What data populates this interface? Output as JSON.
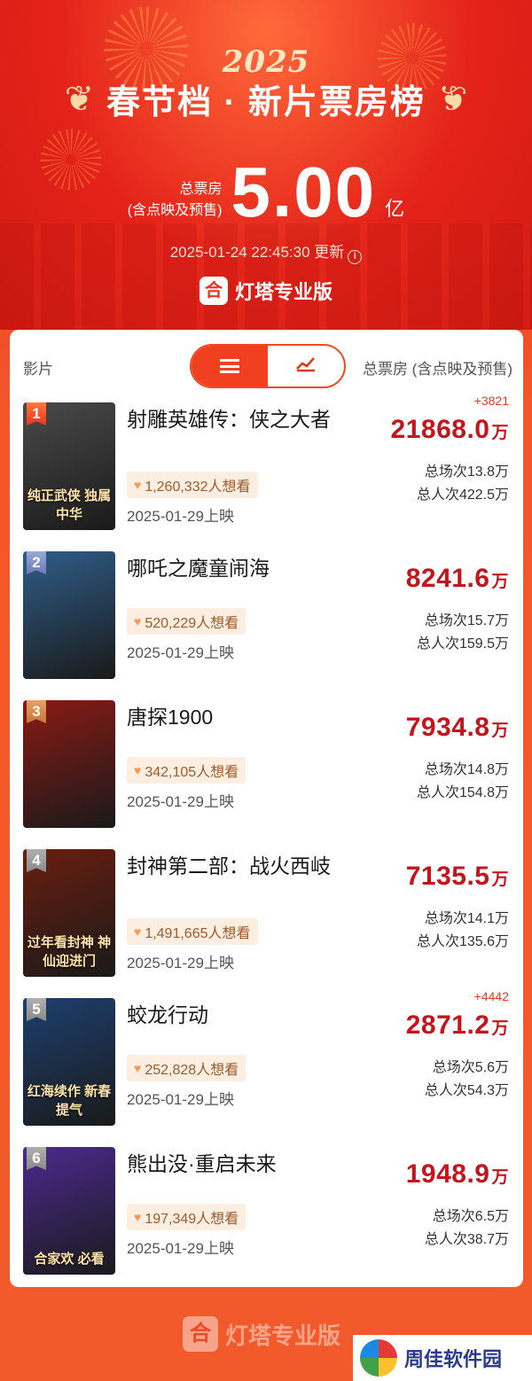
{
  "header": {
    "year": "2025",
    "title": "春节档 · 新片票房榜",
    "total_label_line1": "总票房",
    "total_label_line2": "(含点映及预售)",
    "total_value": "5.00",
    "total_unit": "亿",
    "updated": "2025-01-24 22:45:30 更新",
    "brand_logo": "合",
    "brand_name": "灯塔专业版"
  },
  "table": {
    "col_film": "影片",
    "col_total": "总票房 (含点映及预售)",
    "view_toggle": {
      "active": "list",
      "options": [
        "list-icon",
        "chart-icon"
      ]
    }
  },
  "films": [
    {
      "rank": "1",
      "title": "射雕英雄传：侠之大者",
      "title_lines": 2,
      "want": "1,260,332人想看",
      "release": "2025-01-29上映",
      "delta": "+3821",
      "box_office": "21868.0",
      "unit": "万",
      "screenings": "总场次13.8万",
      "admissions": "总人次422.5万",
      "poster_text": "纯正武侠 独属中华",
      "poster_color": "#4a4a4a"
    },
    {
      "rank": "2",
      "title": "哪吒之魔童闹海",
      "title_lines": 1,
      "want": "520,229人想看",
      "release": "2025-01-29上映",
      "delta": "",
      "box_office": "8241.6",
      "unit": "万",
      "screenings": "总场次15.7万",
      "admissions": "总人次159.5万",
      "poster_text": "",
      "poster_color": "#2f5d88"
    },
    {
      "rank": "3",
      "title": "唐探1900",
      "title_lines": 1,
      "want": "342,105人想看",
      "release": "2025-01-29上映",
      "delta": "",
      "box_office": "7934.8",
      "unit": "万",
      "screenings": "总场次14.8万",
      "admissions": "总人次154.8万",
      "poster_text": "",
      "poster_color": "#8a1a14"
    },
    {
      "rank": "4",
      "title": "封神第二部：战火西岐",
      "title_lines": 2,
      "want": "1,491,665人想看",
      "release": "2025-01-29上映",
      "delta": "",
      "box_office": "7135.5",
      "unit": "万",
      "screenings": "总场次14.1万",
      "admissions": "总人次135.6万",
      "poster_text": "过年看封神 神仙迎进门",
      "poster_color": "#6a1e0e"
    },
    {
      "rank": "5",
      "title": "蛟龙行动",
      "title_lines": 1,
      "want": "252,828人想看",
      "release": "2025-01-29上映",
      "delta": "+4442",
      "box_office": "2871.2",
      "unit": "万",
      "screenings": "总场次5.6万",
      "admissions": "总人次54.3万",
      "poster_text": "红海续作 新春提气",
      "poster_color": "#1d3f6e"
    },
    {
      "rank": "6",
      "title": "熊出没·重启未来",
      "title_lines": 1,
      "want": "197,349人想看",
      "release": "2025-01-29上映",
      "delta": "",
      "box_office": "1948.9",
      "unit": "万",
      "screenings": "总场次6.5万",
      "admissions": "总人次38.7万",
      "poster_text": "合家欢 必看",
      "poster_color": "#4b2a8f"
    }
  ],
  "footer": {
    "brand_logo": "合",
    "brand_name": "灯塔专业版"
  },
  "watermark": {
    "text": "周佳软件园"
  }
}
